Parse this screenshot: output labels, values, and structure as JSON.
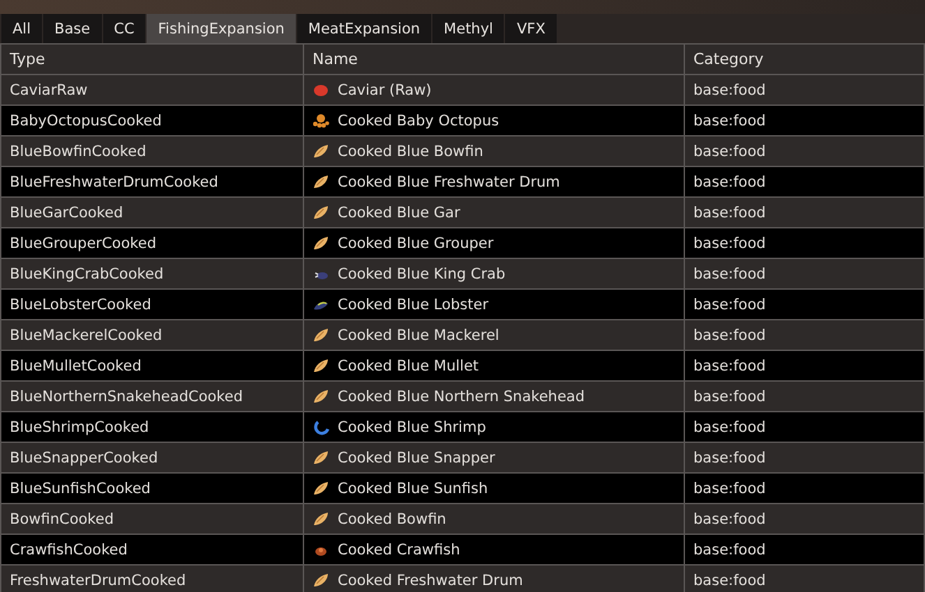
{
  "tabs": [
    {
      "label": "All",
      "selected": false
    },
    {
      "label": "Base",
      "selected": false
    },
    {
      "label": "CC",
      "selected": false
    },
    {
      "label": "FishingExpansion",
      "selected": true
    },
    {
      "label": "MeatExpansion",
      "selected": false
    },
    {
      "label": "Methyl",
      "selected": false
    },
    {
      "label": "VFX",
      "selected": false
    }
  ],
  "table": {
    "columns": [
      "Type",
      "Name",
      "Category"
    ],
    "rows": [
      {
        "type": "CaviarRaw",
        "name": "Caviar (Raw)",
        "category": "base:food",
        "kind": "caviar"
      },
      {
        "type": "BabyOctopusCooked",
        "name": "Cooked Baby Octopus",
        "category": "base:food",
        "kind": "octopus"
      },
      {
        "type": "BlueBowfinCooked",
        "name": "Cooked Blue Bowfin",
        "category": "base:food",
        "kind": "fish"
      },
      {
        "type": "BlueFreshwaterDrumCooked",
        "name": "Cooked Blue Freshwater Drum",
        "category": "base:food",
        "kind": "fish"
      },
      {
        "type": "BlueGarCooked",
        "name": "Cooked Blue Gar",
        "category": "base:food",
        "kind": "fish"
      },
      {
        "type": "BlueGrouperCooked",
        "name": "Cooked Blue Grouper",
        "category": "base:food",
        "kind": "fish"
      },
      {
        "type": "BlueKingCrabCooked",
        "name": "Cooked Blue King Crab",
        "category": "base:food",
        "kind": "crab"
      },
      {
        "type": "BlueLobsterCooked",
        "name": "Cooked Blue Lobster",
        "category": "base:food",
        "kind": "lobster"
      },
      {
        "type": "BlueMackerelCooked",
        "name": "Cooked Blue Mackerel",
        "category": "base:food",
        "kind": "fish"
      },
      {
        "type": "BlueMulletCooked",
        "name": "Cooked Blue Mullet",
        "category": "base:food",
        "kind": "fish"
      },
      {
        "type": "BlueNorthernSnakeheadCooked",
        "name": "Cooked Blue Northern Snakehead",
        "category": "base:food",
        "kind": "fish"
      },
      {
        "type": "BlueShrimpCooked",
        "name": "Cooked Blue Shrimp",
        "category": "base:food",
        "kind": "shrimp"
      },
      {
        "type": "BlueSnapperCooked",
        "name": "Cooked Blue Snapper",
        "category": "base:food",
        "kind": "fish"
      },
      {
        "type": "BlueSunfishCooked",
        "name": "Cooked Blue Sunfish",
        "category": "base:food",
        "kind": "fish"
      },
      {
        "type": "BowfinCooked",
        "name": "Cooked Bowfin",
        "category": "base:food",
        "kind": "fish"
      },
      {
        "type": "CrawfishCooked",
        "name": "Cooked Crawfish",
        "category": "base:food",
        "kind": "crawfish"
      },
      {
        "type": "FreshwaterDrumCooked",
        "name": "Cooked Freshwater Drum",
        "category": "base:food",
        "kind": "fish"
      }
    ]
  }
}
